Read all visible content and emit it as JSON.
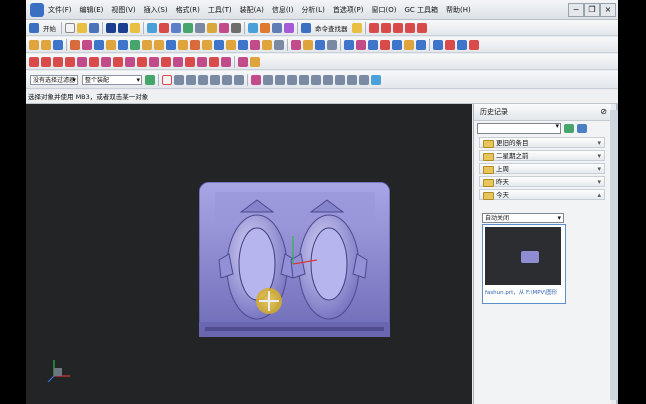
{
  "menubar": {
    "items": [
      "文件(F)",
      "编辑(E)",
      "视图(V)",
      "插入(S)",
      "格式(R)",
      "工具(T)",
      "装配(A)",
      "信息(I)",
      "分析(L)",
      "首选项(P)",
      "窗口(O)",
      "GC 工具箱",
      "帮助(H)"
    ]
  },
  "toolbar1": {
    "start_label": "开始",
    "command_finder_label": "命令查找器"
  },
  "toolbar3": {
    "selection_filter": "没有选择过滤器",
    "selection_scope": "整个装配"
  },
  "status": {
    "prompt": "选择对象并使用 MB3，或者双击某一对象"
  },
  "history": {
    "title": "历史记录",
    "groups": [
      "更旧的条目",
      "二星期之前",
      "上周",
      "昨天",
      "今天"
    ],
    "filter_value": "自动关闭",
    "thumbnail_caption": "fashun.prt，从 F:\\MPV\\图形"
  },
  "colors": {
    "model": "#8f8cd2",
    "viewport": "#222426",
    "accent": "#3b6fc1"
  }
}
